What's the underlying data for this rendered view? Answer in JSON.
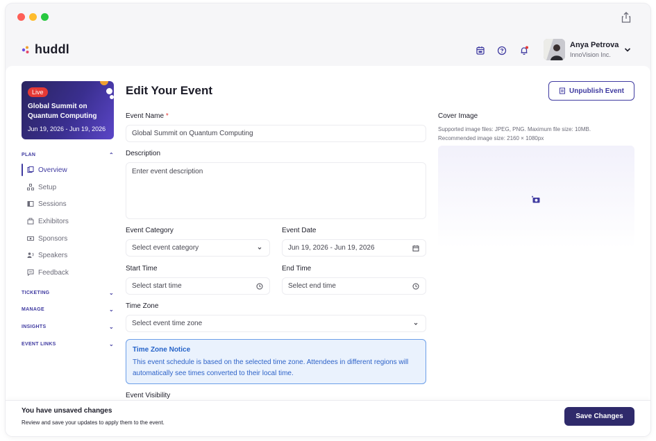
{
  "app": {
    "brand": "huddl"
  },
  "user": {
    "name": "Anya Petrova",
    "org": "InnoVision Inc."
  },
  "event_card": {
    "badge": "Live",
    "title": "Global Summit on Quantum Computing",
    "dates": "Jun 19, 2026 - Jun 19, 2026"
  },
  "nav": {
    "plan": "PLAN",
    "items": [
      {
        "label": "Overview",
        "icon": "overview-icon"
      },
      {
        "label": "Setup",
        "icon": "setup-icon"
      },
      {
        "label": "Sessions",
        "icon": "sessions-icon"
      },
      {
        "label": "Exhibitors",
        "icon": "exhibitors-icon"
      },
      {
        "label": "Sponsors",
        "icon": "sponsors-icon"
      },
      {
        "label": "Speakers",
        "icon": "speakers-icon"
      },
      {
        "label": "Feedback",
        "icon": "feedback-icon"
      }
    ],
    "sections": [
      "TICKETING",
      "MANAGE",
      "INSIGHTS",
      "EVENT LINKS"
    ]
  },
  "page": {
    "title": "Edit Your Event",
    "unpublish_label": "Unpublish Event"
  },
  "form": {
    "event_name": {
      "label": "Event Name",
      "required_mark": "*",
      "value": "Global Summit on Quantum Computing"
    },
    "description": {
      "label": "Description",
      "placeholder": "Enter event description"
    },
    "category": {
      "label": "Event Category",
      "placeholder": "Select event category"
    },
    "date": {
      "label": "Event Date",
      "value": "Jun 19, 2026 - Jun 19, 2026"
    },
    "start_time": {
      "label": "Start Time",
      "placeholder": "Select start time"
    },
    "end_time": {
      "label": "End Time",
      "placeholder": "Select end time"
    },
    "time_zone": {
      "label": "Time Zone",
      "placeholder": "Select event time zone"
    },
    "visibility": {
      "label": "Event Visibility"
    }
  },
  "notice": {
    "title": "Time Zone Notice",
    "text": "This event schedule is based on the selected time zone. Attendees in different regions will automatically see times converted to their local time."
  },
  "cover": {
    "label": "Cover Image",
    "hint_line1": "Supported image files: JPEG, PNG. Maximum file size: 10MB.",
    "hint_line2": "Recommended image size: 2160 × 1080px"
  },
  "footer": {
    "title": "You have unsaved changes",
    "subtitle": "Review and save your updates to apply them to the event.",
    "save_label": "Save Changes"
  },
  "colors": {
    "accent": "#3f3aa0",
    "notice_bg": "#eaf2fd",
    "notice_text": "#2563c9",
    "live": "#e53935"
  }
}
